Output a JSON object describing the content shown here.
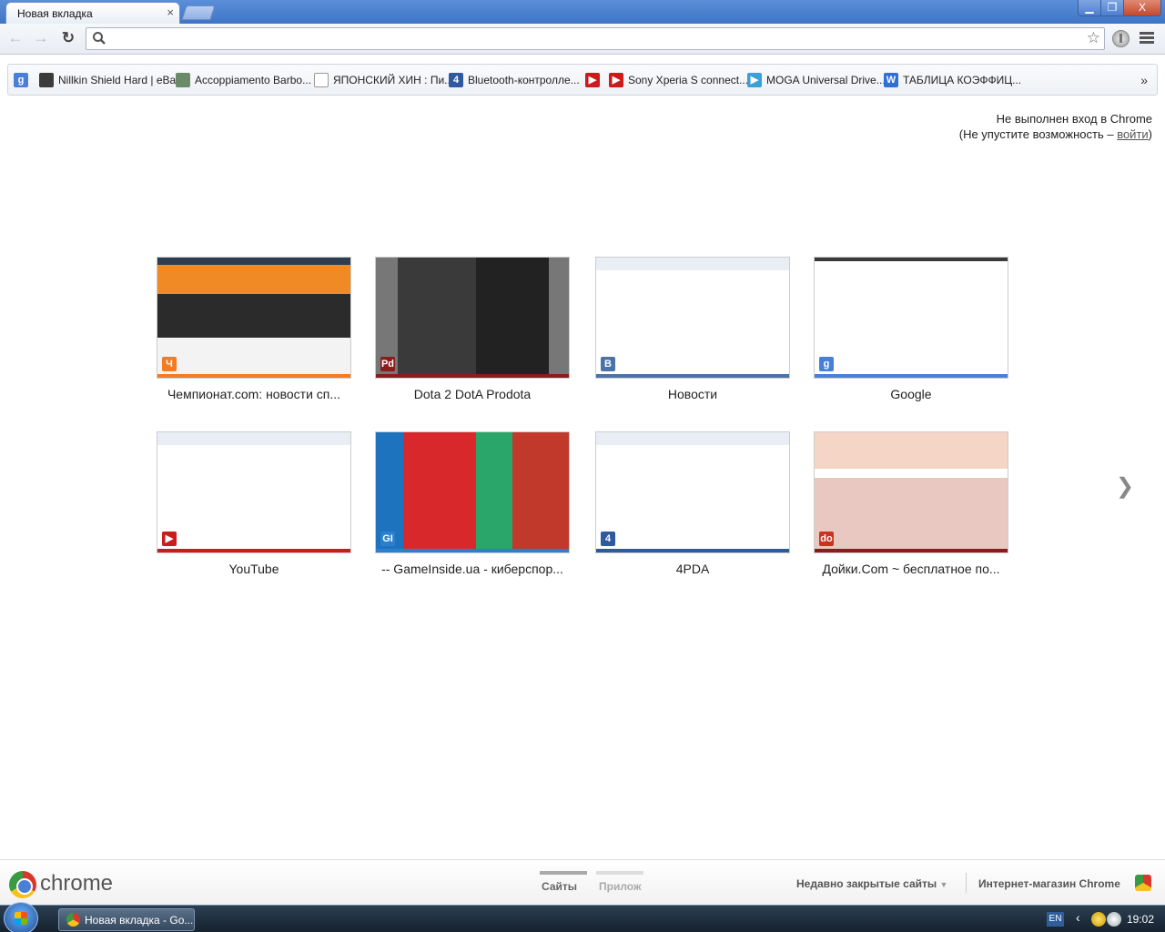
{
  "window": {
    "tab_title": "Новая вкладка",
    "tab_close": "×",
    "minimize": "▁",
    "maximize": "❐",
    "close": "X"
  },
  "toolbar": {
    "back": "←",
    "forward": "→",
    "reload": "↻",
    "omnibox_value": "",
    "star": "☆"
  },
  "bookmarks": {
    "items": [
      {
        "label": "",
        "icon": "google-icon",
        "color": "#4a7fd8",
        "glyph": "g"
      },
      {
        "label": "Nillkin Shield Hard | eBay",
        "icon": "nillkin-icon",
        "color": "#3b3b3b",
        "glyph": ""
      },
      {
        "label": "Accoppiamento Barbo...",
        "icon": "page-icon",
        "color": "#6a8a6a",
        "glyph": ""
      },
      {
        "label": "ЯПОНСКИЙ ХИН : Пи...",
        "icon": "blank-page-icon",
        "color": "#ffffff",
        "glyph": ""
      },
      {
        "label": "Bluetooth-контролле...",
        "icon": "4pda-icon",
        "color": "#2f5aa0",
        "glyph": "4"
      },
      {
        "label": "",
        "icon": "youtube-icon",
        "color": "#cc1b1b",
        "glyph": "▶"
      },
      {
        "label": "Sony Xperia S connect...",
        "icon": "youtube-icon",
        "color": "#cc1b1b",
        "glyph": "▶"
      },
      {
        "label": "MOGA Universal Drive...",
        "icon": "play-store-icon",
        "color": "#3aa0d8",
        "glyph": "▶"
      },
      {
        "label": "ТАБЛИЦА КОЭФФИЦ...",
        "icon": "word-icon",
        "color": "#2f6fd8",
        "glyph": "W"
      }
    ],
    "more": "»"
  },
  "signin": {
    "line1": "Не выполнен вход в Chrome",
    "line2_prefix": "(Не упустите возможность – ",
    "link": "войти",
    "line2_suffix": ")"
  },
  "most_visited": [
    {
      "title": "Чемпионат.com: новости сп...",
      "fav": "Ч",
      "fav_color": "#f47b20",
      "bar": "#f47b20",
      "theme": "dark"
    },
    {
      "title": "Dota 2 DotA Prodota",
      "fav": "Pd",
      "fav_color": "#8a1c1c",
      "bar": "#8a1c1c",
      "theme": "gray"
    },
    {
      "title": "Новости",
      "fav": "В",
      "fav_color": "#4a74a8",
      "bar": "#4a74a8",
      "theme": "light"
    },
    {
      "title": "Google",
      "fav": "g",
      "fav_color": "#4a7fd8",
      "bar": "#4a7fd8",
      "theme": "white"
    },
    {
      "title": "YouTube",
      "fav": "▶",
      "fav_color": "#cc1b1b",
      "bar": "#cc1b1b",
      "theme": "light"
    },
    {
      "title": "-- GameInside.ua - киберспор...",
      "fav": "GI",
      "fav_color": "#2a7fd0",
      "bar": "#2a7fd0",
      "theme": "colorful"
    },
    {
      "title": "4PDA",
      "fav": "4",
      "fav_color": "#2f5aa0",
      "bar": "#2f5aa0",
      "theme": "light"
    },
    {
      "title": "Дойки.Com ~ бесплатное по...",
      "fav": "do",
      "fav_color": "#c8341e",
      "bar": "#8a1c1c",
      "theme": "pink"
    }
  ],
  "next_page": "❯",
  "footer": {
    "brand": "chrome",
    "tab_sites": "Сайты",
    "tab_apps": "Прилож",
    "recently_closed": "Недавно закрытые сайты",
    "recently_closed_arrow": "▼",
    "webstore": "Интернет-магазин Chrome"
  },
  "taskbar": {
    "task_label": "Новая вкладка - Go...",
    "lang": "EN",
    "tray_arrow": "‹",
    "clock": "19:02"
  },
  "colors": {
    "accent": "#3e74c6",
    "active_pager": "#aaaaaa",
    "inactive_pager": "#dddddd"
  }
}
